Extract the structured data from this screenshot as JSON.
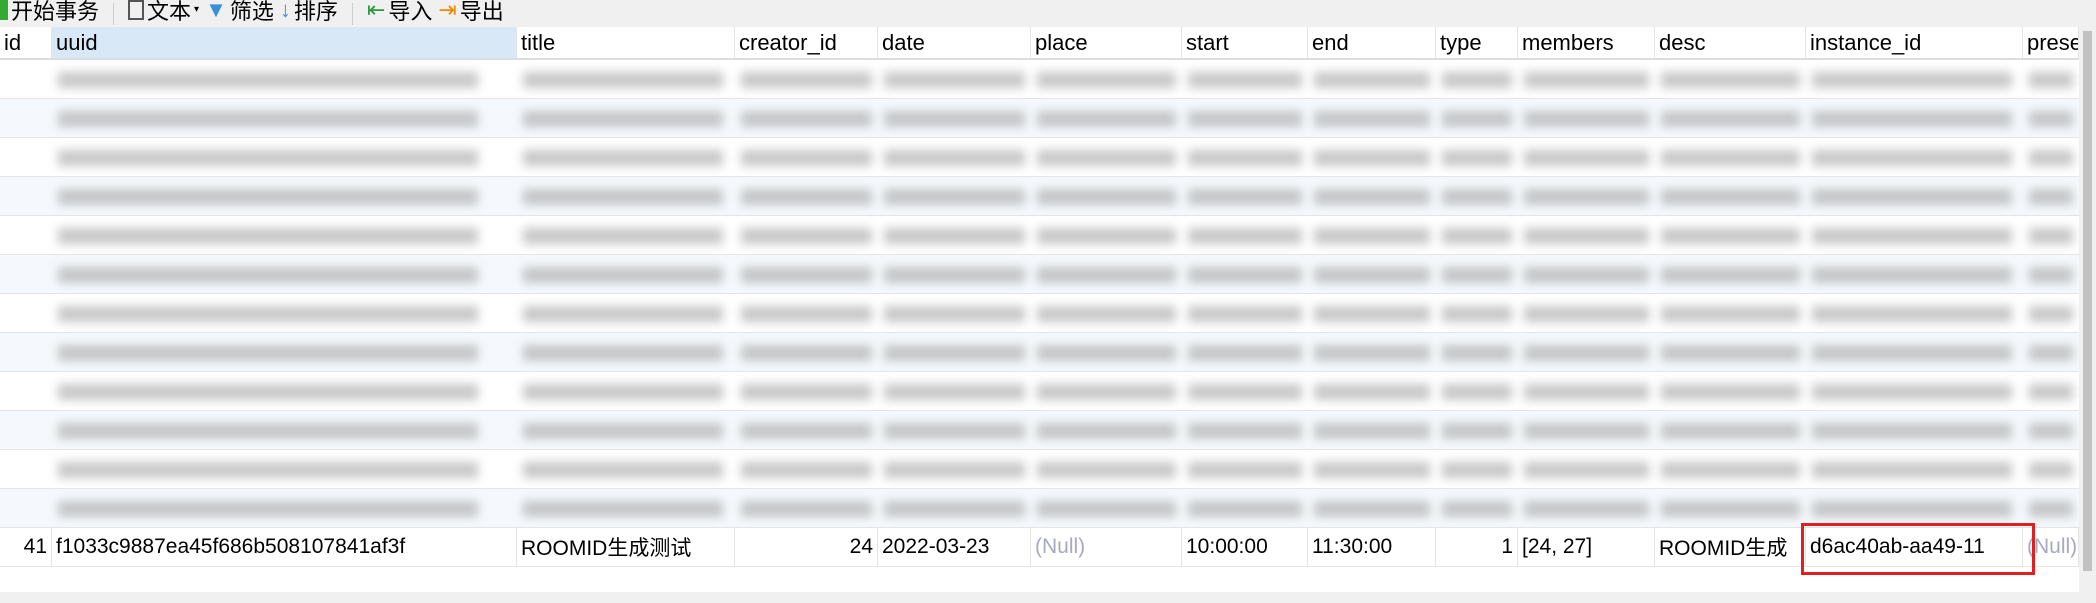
{
  "toolbar": {
    "begin_transaction": "开始事务",
    "text": "文本",
    "filter": "筛选",
    "sort": "排序",
    "import": "导入",
    "export": "导出"
  },
  "columns": [
    "id",
    "uuid",
    "title",
    "creator_id",
    "date",
    "place",
    "start",
    "end",
    "type",
    "members",
    "desc",
    "instance_id",
    "prese"
  ],
  "highlighted_row": {
    "id": "41",
    "uuid": "f1033c9887ea45f686b508107841af3f",
    "title": "ROOMID生成测试",
    "creator_id": "24",
    "date": "2022-03-23",
    "place": "(Null)",
    "start": "10:00:00",
    "end": "11:30:00",
    "type": "1",
    "members": "[24, 27]",
    "desc": "ROOMID生成",
    "instance_id": "d6ac40ab-aa49-11",
    "prese": "(Null)"
  },
  "colors": {
    "header_selected": "#d9e8f6",
    "highlight_box": "#e02020",
    "null_text": "#a8a8c0"
  }
}
